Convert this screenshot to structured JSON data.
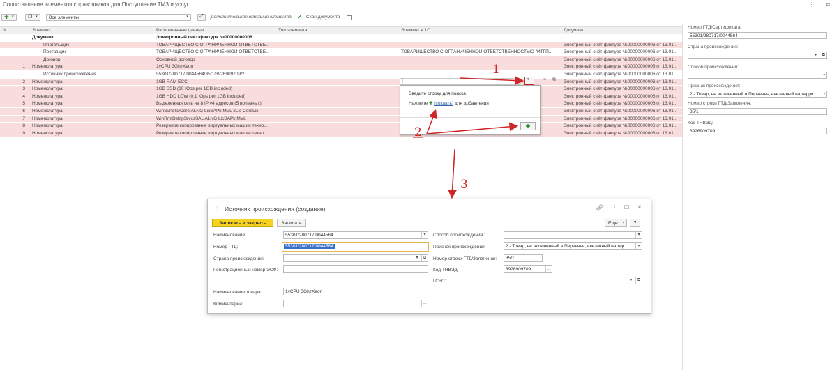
{
  "window": {
    "title": "Сопоставление элементов справочников для Поступление ТМЗ и услуг",
    "menu_icon": "more-vertical-icon",
    "restore_icon": "restore-icon"
  },
  "toolbar": {
    "filter_value": "Все элементы",
    "additional_desc_label": "Дополнительное описание элемента",
    "scan_label": "Скан документа"
  },
  "grid": {
    "columns": [
      "N",
      "Элемент",
      "Распознанные данные",
      "Тип элемента",
      "Элемент в 1С",
      "Документ"
    ],
    "rows": [
      {
        "n": "",
        "element": "Документ",
        "recognized": "Электронный счёт-фактура №00000000006 ...",
        "type": "",
        "element1c": "",
        "doc": "",
        "bold": true,
        "color": "white"
      },
      {
        "n": "",
        "element": "Плательщик",
        "recognized": "ТОВАРИЩЕСТВО С ОГРАНИЧЕННОЙ ОТВЕТСТВЕ...",
        "type": "",
        "element1c": "",
        "doc": "Электронный счёт-фактура №00000000006 от 13.01...",
        "color": "pink"
      },
      {
        "n": "",
        "element": "Поставщик",
        "recognized": "ТОВАРИЩЕСТВО С ОГРАНИЧЕННОЙ ОТВЕТСТВЕ...",
        "type": "",
        "element1c": "ТОВАРИЩЕСТВО С ОГРАНИЧЕННОЙ ОТВЕТСТВЕННОСТЬЮ \"ИТГП...",
        "doc": "Электронный счёт-фактура №00000000006 от 13.01...",
        "color": "white"
      },
      {
        "n": "",
        "element": "Договор",
        "recognized": "Основной договор",
        "type": "",
        "element1c": "",
        "doc": "Электронный счёт-фактура №00000000006 от 13.01...",
        "color": "pink"
      },
      {
        "n": "1",
        "element": "Номенклатура",
        "recognized": "1vCPU 3GhzXeon",
        "type": "",
        "element1c": "",
        "doc": "Электронный счёт-фактура №00000000006 от 13.01...",
        "color": "pink"
      },
      {
        "n": "",
        "element": "Источник происхождения",
        "recognized": "55301/280717/0044564/35/1/3926909709/2",
        "type": "",
        "element1c": "",
        "doc": "Электронный счёт-фактура №00000000006 от 13.01...",
        "color": "white"
      },
      {
        "n": "2",
        "element": "Номенклатура",
        "recognized": "1GB RAM ECC",
        "type": "",
        "element1c": "",
        "doc": "Электронный счёт-фактура №00000000006 от 13.01...",
        "color": "pink"
      },
      {
        "n": "3",
        "element": "Номенклатура",
        "recognized": "1GB SSD (30 IOps per 1GB included)",
        "type": "",
        "element1c": "",
        "doc": "Электронный счёт-фактура №00000000006 от 13.01...",
        "color": "pink"
      },
      {
        "n": "4",
        "element": "Номенклатура",
        "recognized": "1GB HDD LOW (0,1 IOps per 1GB included)",
        "type": "",
        "element1c": "",
        "doc": "Электронный счёт-фактура №00000000006 от 13.01...",
        "color": "pink"
      },
      {
        "n": "5",
        "element": "Номенклатура",
        "recognized": "Выделенная сеть на 8 IP v4 адресов (5 полезных)",
        "type": "",
        "element1c": "",
        "doc": "Электронный счёт-фактура №00000000006 от 13.01...",
        "color": "pink"
      },
      {
        "n": "6",
        "element": "Номенклатура",
        "recognized": "WinSvrSTDCore ALNG LicSAPk MVL 2Lic CoreLic",
        "type": "",
        "element1c": "",
        "doc": "Электронный счёт-фактура №00000000006 от 13.01...",
        "color": "pink"
      },
      {
        "n": "7",
        "element": "Номенклатура",
        "recognized": "WinRmtDsktpSrvcsSAL ALNG LicSAPk MVL",
        "type": "",
        "element1c": "",
        "doc": "Электронный счёт-фактура №00000000006 от 13.01...",
        "color": "pink"
      },
      {
        "n": "8",
        "element": "Номенклатура",
        "recognized": "Резервное копирование виртуальных машин техно...",
        "type": "",
        "element1c": "",
        "doc": "Электронный счёт-фактура №00000000006 от 13.01...",
        "color": "pink"
      },
      {
        "n": "9",
        "element": "Номенклатура",
        "recognized": "Резервное копирование виртуальных машин техно...",
        "type": "",
        "element1c": "",
        "doc": "Электронный счёт-фактура №00000000006 от 13.01...",
        "color": "pink"
      }
    ]
  },
  "popup": {
    "line1": "Введите строку для поиска",
    "line2_prefix": "Нажмите",
    "create_link": "(создать)",
    "line2_suffix": "для добавления"
  },
  "right_panel": {
    "gtd_label": "Номер ГТД/Сертификата:",
    "gtd_value": "55301/280717/0044564",
    "country_label": "Страна происхождения:",
    "country_value": "",
    "method_label": "Способ происхождения:",
    "method_value": "",
    "sign_label": "Признак происхождения:",
    "sign_value": "2 - Товар, не включенный в Перечень, ввезенный на терри",
    "line_label": "Номер строки ГТД/Заявления:",
    "line_value": "35/1",
    "tnved_label": "Код ТНВЭД:",
    "tnved_value": "3926909709"
  },
  "annotations": {
    "n1": "1",
    "n2": "2",
    "n3": "3"
  },
  "dialog": {
    "title": "Источник происхождения (создание)",
    "save_close": "Записать и закрыть",
    "save": "Записать",
    "more": "Еще",
    "help": "?",
    "name_label": "Наименование:",
    "name_value": "55301/280717/0044564",
    "gtd_label": "Номер ГТД:",
    "gtd_value": "55301/280717/0044564",
    "country_label": "Страна происхождения:",
    "country_value": "",
    "reg_label": "Регистрационный номер ЭСФ:",
    "reg_value": "",
    "method_label": "Способ происхождения :",
    "method_value": "",
    "sign_label": "Признак происхождения:",
    "sign_value": "2 - Товар, не включенный в Перечень, ввезенный на тер",
    "line_label": "Номер строки ГТД/Заявления:",
    "line_value": "35/1",
    "tnved_label": "Код ТНВЭД:",
    "tnved_value": "3926909709",
    "gsvs_label": "ГСВС:",
    "gsvs_value": "",
    "goods_label": "Наименование товара:",
    "goods_value": "1vCPU 3GhzXeon",
    "comment_label": "Комментарий:",
    "comment_value": ""
  },
  "colors": {
    "accent_red": "#d0262a",
    "row_pink": "#f9dcdc",
    "save_yellow": "#f5d21f"
  }
}
